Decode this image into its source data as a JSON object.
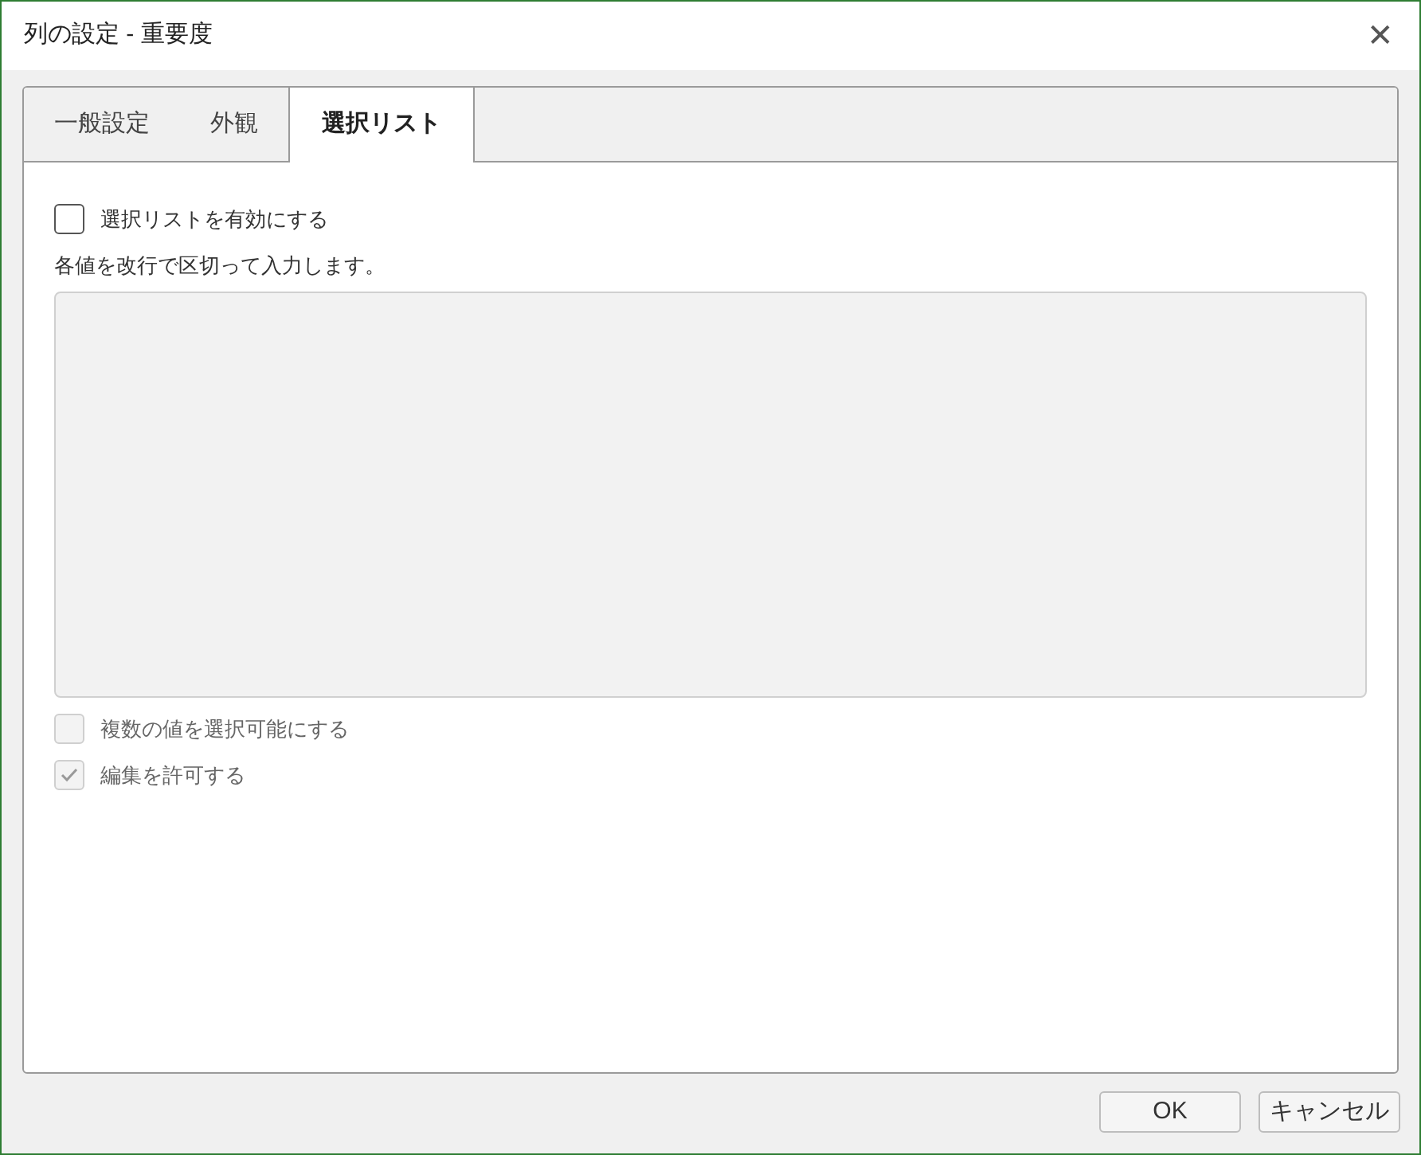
{
  "window": {
    "title": "列の設定 - 重要度",
    "close": "✕"
  },
  "tabs": [
    {
      "label": "一般設定",
      "selected": false
    },
    {
      "label": "外観",
      "selected": false
    },
    {
      "label": "選択リスト",
      "selected": true
    }
  ],
  "enable_option": {
    "label": "選択リストを有効にする",
    "checked": false,
    "disabled": false
  },
  "instructions": "各値を改行で区切って入力します。",
  "values_box": {
    "disabled": true
  },
  "options": [
    {
      "label": "複数の値を選択可能にする",
      "checked": false,
      "disabled": true
    },
    {
      "label": "編集を許可する",
      "checked": true,
      "disabled": true
    }
  ],
  "buttons": [
    "OK",
    "キャンセル"
  ]
}
